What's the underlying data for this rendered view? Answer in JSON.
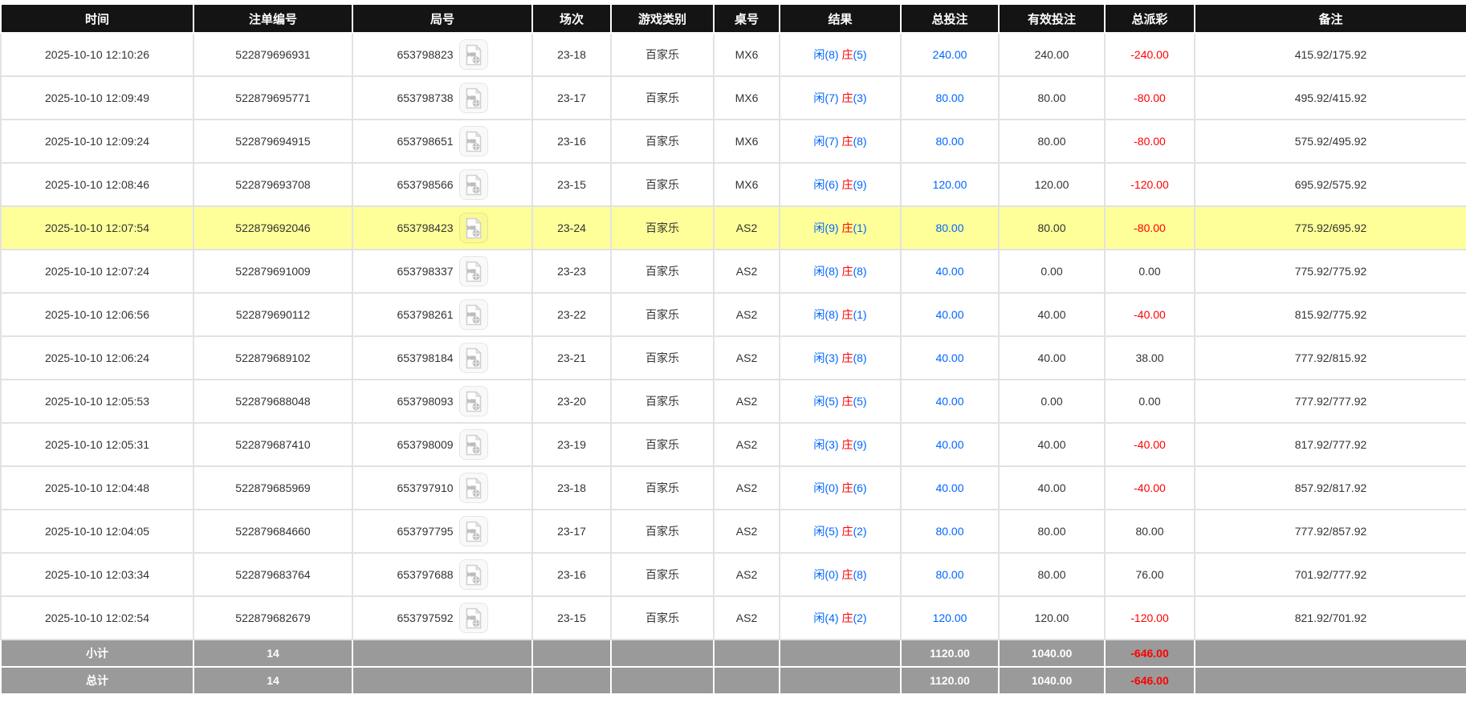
{
  "colors": {
    "header_bg": "#141414",
    "header_text": "#ffffff",
    "row_highlight_bg": "#ffff99",
    "summary_bg": "#9a9a9a",
    "link_blue": "#0066ff",
    "negative_red": "#ff0000"
  },
  "icons": {
    "round_replay": "video-file-icon"
  },
  "table": {
    "headers": [
      {
        "key": "time",
        "label": "时间"
      },
      {
        "key": "order_no",
        "label": "注单编号"
      },
      {
        "key": "round_no",
        "label": "局号"
      },
      {
        "key": "session",
        "label": "场次"
      },
      {
        "key": "game_type",
        "label": "游戏类别"
      },
      {
        "key": "table_no",
        "label": "桌号"
      },
      {
        "key": "result",
        "label": "结果"
      },
      {
        "key": "total_bet",
        "label": "总投注"
      },
      {
        "key": "valid_bet",
        "label": "有效投注"
      },
      {
        "key": "payout",
        "label": "总派彩"
      },
      {
        "key": "remark",
        "label": "备注"
      }
    ],
    "rows": [
      {
        "time": "2025-10-10 12:10:26",
        "order_no": "522879696931",
        "round_no": "653798823",
        "session": "23-18",
        "game_type": "百家乐",
        "table_no": "MX6",
        "result": {
          "player": "闲(8)",
          "banker_label": "庄",
          "banker_score": "(5)"
        },
        "total_bet": "240.00",
        "valid_bet": "240.00",
        "payout": "-240.00",
        "remark": "415.92/175.92",
        "highlighted": false
      },
      {
        "time": "2025-10-10 12:09:49",
        "order_no": "522879695771",
        "round_no": "653798738",
        "session": "23-17",
        "game_type": "百家乐",
        "table_no": "MX6",
        "result": {
          "player": "闲(7)",
          "banker_label": "庄",
          "banker_score": "(3)"
        },
        "total_bet": "80.00",
        "valid_bet": "80.00",
        "payout": "-80.00",
        "remark": "495.92/415.92",
        "highlighted": false
      },
      {
        "time": "2025-10-10 12:09:24",
        "order_no": "522879694915",
        "round_no": "653798651",
        "session": "23-16",
        "game_type": "百家乐",
        "table_no": "MX6",
        "result": {
          "player": "闲(7)",
          "banker_label": "庄",
          "banker_score": "(8)"
        },
        "total_bet": "80.00",
        "valid_bet": "80.00",
        "payout": "-80.00",
        "remark": "575.92/495.92",
        "highlighted": false
      },
      {
        "time": "2025-10-10 12:08:46",
        "order_no": "522879693708",
        "round_no": "653798566",
        "session": "23-15",
        "game_type": "百家乐",
        "table_no": "MX6",
        "result": {
          "player": "闲(6)",
          "banker_label": "庄",
          "banker_score": "(9)"
        },
        "total_bet": "120.00",
        "valid_bet": "120.00",
        "payout": "-120.00",
        "remark": "695.92/575.92",
        "highlighted": false
      },
      {
        "time": "2025-10-10 12:07:54",
        "order_no": "522879692046",
        "round_no": "653798423",
        "session": "23-24",
        "game_type": "百家乐",
        "table_no": "AS2",
        "result": {
          "player": "闲(9)",
          "banker_label": "庄",
          "banker_score": "(1)"
        },
        "total_bet": "80.00",
        "valid_bet": "80.00",
        "payout": "-80.00",
        "remark": "775.92/695.92",
        "highlighted": true
      },
      {
        "time": "2025-10-10 12:07:24",
        "order_no": "522879691009",
        "round_no": "653798337",
        "session": "23-23",
        "game_type": "百家乐",
        "table_no": "AS2",
        "result": {
          "player": "闲(8)",
          "banker_label": "庄",
          "banker_score": "(8)"
        },
        "total_bet": "40.00",
        "valid_bet": "0.00",
        "payout": "0.00",
        "remark": "775.92/775.92",
        "highlighted": false
      },
      {
        "time": "2025-10-10 12:06:56",
        "order_no": "522879690112",
        "round_no": "653798261",
        "session": "23-22",
        "game_type": "百家乐",
        "table_no": "AS2",
        "result": {
          "player": "闲(8)",
          "banker_label": "庄",
          "banker_score": "(1)"
        },
        "total_bet": "40.00",
        "valid_bet": "40.00",
        "payout": "-40.00",
        "remark": "815.92/775.92",
        "highlighted": false
      },
      {
        "time": "2025-10-10 12:06:24",
        "order_no": "522879689102",
        "round_no": "653798184",
        "session": "23-21",
        "game_type": "百家乐",
        "table_no": "AS2",
        "result": {
          "player": "闲(3)",
          "banker_label": "庄",
          "banker_score": "(8)"
        },
        "total_bet": "40.00",
        "valid_bet": "40.00",
        "payout": "38.00",
        "remark": "777.92/815.92",
        "highlighted": false
      },
      {
        "time": "2025-10-10 12:05:53",
        "order_no": "522879688048",
        "round_no": "653798093",
        "session": "23-20",
        "game_type": "百家乐",
        "table_no": "AS2",
        "result": {
          "player": "闲(5)",
          "banker_label": "庄",
          "banker_score": "(5)"
        },
        "total_bet": "40.00",
        "valid_bet": "0.00",
        "payout": "0.00",
        "remark": "777.92/777.92",
        "highlighted": false
      },
      {
        "time": "2025-10-10 12:05:31",
        "order_no": "522879687410",
        "round_no": "653798009",
        "session": "23-19",
        "game_type": "百家乐",
        "table_no": "AS2",
        "result": {
          "player": "闲(3)",
          "banker_label": "庄",
          "banker_score": "(9)"
        },
        "total_bet": "40.00",
        "valid_bet": "40.00",
        "payout": "-40.00",
        "remark": "817.92/777.92",
        "highlighted": false
      },
      {
        "time": "2025-10-10 12:04:48",
        "order_no": "522879685969",
        "round_no": "653797910",
        "session": "23-18",
        "game_type": "百家乐",
        "table_no": "AS2",
        "result": {
          "player": "闲(0)",
          "banker_label": "庄",
          "banker_score": "(6)"
        },
        "total_bet": "40.00",
        "valid_bet": "40.00",
        "payout": "-40.00",
        "remark": "857.92/817.92",
        "highlighted": false
      },
      {
        "time": "2025-10-10 12:04:05",
        "order_no": "522879684660",
        "round_no": "653797795",
        "session": "23-17",
        "game_type": "百家乐",
        "table_no": "AS2",
        "result": {
          "player": "闲(5)",
          "banker_label": "庄",
          "banker_score": "(2)"
        },
        "total_bet": "80.00",
        "valid_bet": "80.00",
        "payout": "80.00",
        "remark": "777.92/857.92",
        "highlighted": false
      },
      {
        "time": "2025-10-10 12:03:34",
        "order_no": "522879683764",
        "round_no": "653797688",
        "session": "23-16",
        "game_type": "百家乐",
        "table_no": "AS2",
        "result": {
          "player": "闲(0)",
          "banker_label": "庄",
          "banker_score": "(8)"
        },
        "total_bet": "80.00",
        "valid_bet": "80.00",
        "payout": "76.00",
        "remark": "701.92/777.92",
        "highlighted": false
      },
      {
        "time": "2025-10-10 12:02:54",
        "order_no": "522879682679",
        "round_no": "653797592",
        "session": "23-15",
        "game_type": "百家乐",
        "table_no": "AS2",
        "result": {
          "player": "闲(4)",
          "banker_label": "庄",
          "banker_score": "(2)"
        },
        "total_bet": "120.00",
        "valid_bet": "120.00",
        "payout": "-120.00",
        "remark": "821.92/701.92",
        "highlighted": false
      }
    ],
    "subtotal": {
      "label": "小计",
      "count": "14",
      "total_bet": "1120.00",
      "valid_bet": "1040.00",
      "payout": "-646.00"
    },
    "total": {
      "label": "总计",
      "count": "14",
      "total_bet": "1120.00",
      "valid_bet": "1040.00",
      "payout": "-646.00"
    }
  }
}
